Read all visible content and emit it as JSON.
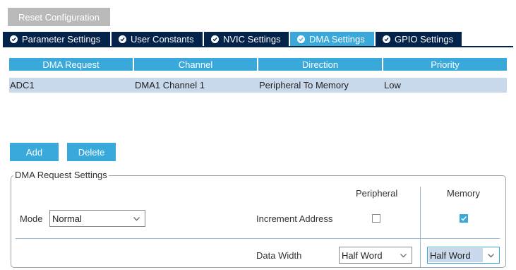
{
  "toolbar": {
    "reset_label": "Reset Configuration"
  },
  "tabs": [
    {
      "label": "Parameter Settings",
      "icon": "check-circle-icon"
    },
    {
      "label": "User Constants",
      "icon": "check-circle-icon"
    },
    {
      "label": "NVIC Settings",
      "icon": "check-circle-icon"
    },
    {
      "label": "DMA Settings",
      "icon": "check-circle-icon",
      "active": true
    },
    {
      "label": "GPIO Settings",
      "icon": "check-circle-icon"
    }
  ],
  "dma_table": {
    "headers": [
      "DMA Request",
      "Channel",
      "Direction",
      "Priority"
    ],
    "rows": [
      [
        "ADC1",
        "DMA1 Channel 1",
        "Peripheral To Memory",
        "Low"
      ]
    ]
  },
  "actions": {
    "add_label": "Add",
    "delete_label": "Delete"
  },
  "settings": {
    "legend": "DMA Request Settings",
    "mode_label": "Mode",
    "mode_value": "Normal",
    "peripheral_header": "Peripheral",
    "memory_header": "Memory",
    "increment_label": "Increment Address",
    "peripheral_increment": false,
    "memory_increment": true,
    "data_width_label": "Data Width",
    "peripheral_width": "Half Word",
    "memory_width": "Half Word"
  },
  "colors": {
    "accent": "#39a9dc",
    "tab_dark": "#03234b",
    "row_selected": "#c8d9ec",
    "reset_button": "#b9b9b9"
  }
}
